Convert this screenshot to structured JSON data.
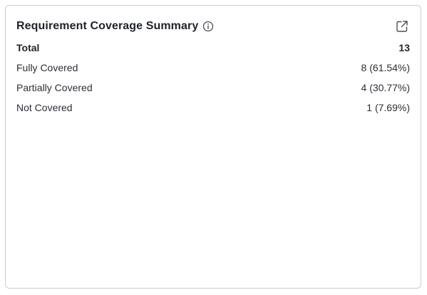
{
  "card": {
    "title": "Requirement Coverage Summary",
    "info_icon": "info-icon",
    "open_icon": "external-link-icon"
  },
  "summary": {
    "total_label": "Total",
    "total_value": "13",
    "rows": [
      {
        "label": "Fully Covered",
        "value": "8 (61.54%)"
      },
      {
        "label": "Partially Covered",
        "value": "4 (30.77%)"
      },
      {
        "label": "Not Covered",
        "value": "1 (7.69%)"
      }
    ]
  },
  "colors": {
    "text": "#1f2329",
    "border": "#c9ccd1",
    "icon": "#4a4f57"
  }
}
